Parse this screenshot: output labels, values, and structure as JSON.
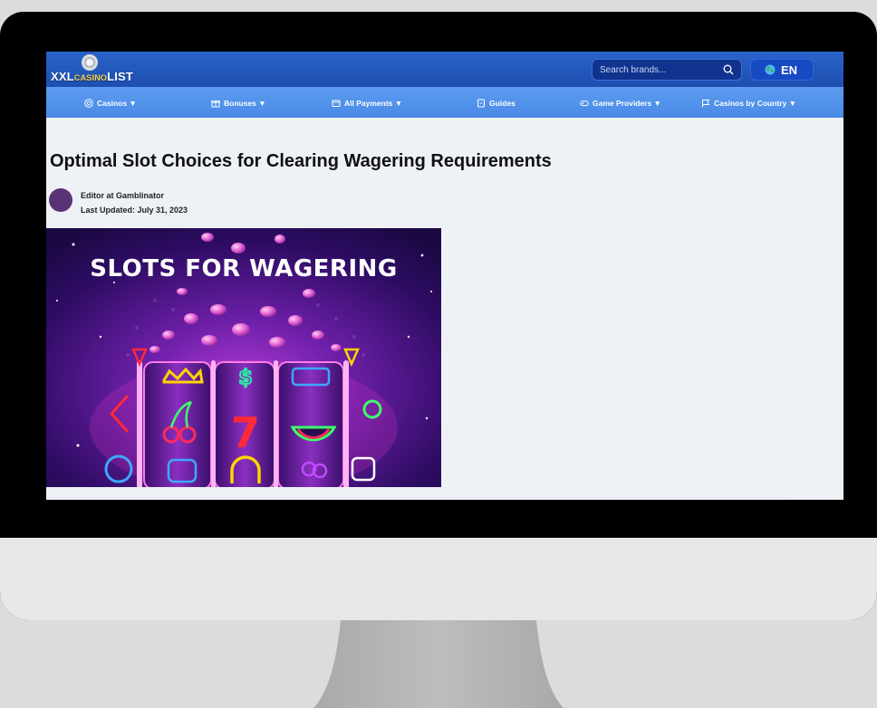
{
  "site": {
    "logo_text": {
      "xxl": "XXL",
      "casino": "CASINO",
      "list": "LIST"
    },
    "search": {
      "placeholder": "Search brands..."
    },
    "language": "EN"
  },
  "nav": [
    {
      "label": "Casinos ▼",
      "icon": "casino-chip-icon"
    },
    {
      "label": "Bonuses ▼",
      "icon": "gift-icon"
    },
    {
      "label": "All Payments ▼",
      "icon": "wallet-icon"
    },
    {
      "label": "Guides",
      "icon": "document-icon"
    },
    {
      "label": "Game Providers ▼",
      "icon": "gamepad-icon"
    },
    {
      "label": "Casinos by Country ▼",
      "icon": "flag-icon"
    }
  ],
  "article": {
    "title": "Optimal Slot Choices for Clearing Wagering Requirements",
    "author": "Editor at Gamblinator",
    "updated": "Last Updated: July 31, 2023",
    "hero_text": "SLOTS FOR WAGERING"
  },
  "colors": {
    "topbar": "#1d4fb0",
    "navbar": "#4a8ae6",
    "page_bg": "#eef1f6",
    "avatar": "#5a3377",
    "hero_bg": "#2a0b52",
    "neon_pink": "#ff3fd2"
  }
}
